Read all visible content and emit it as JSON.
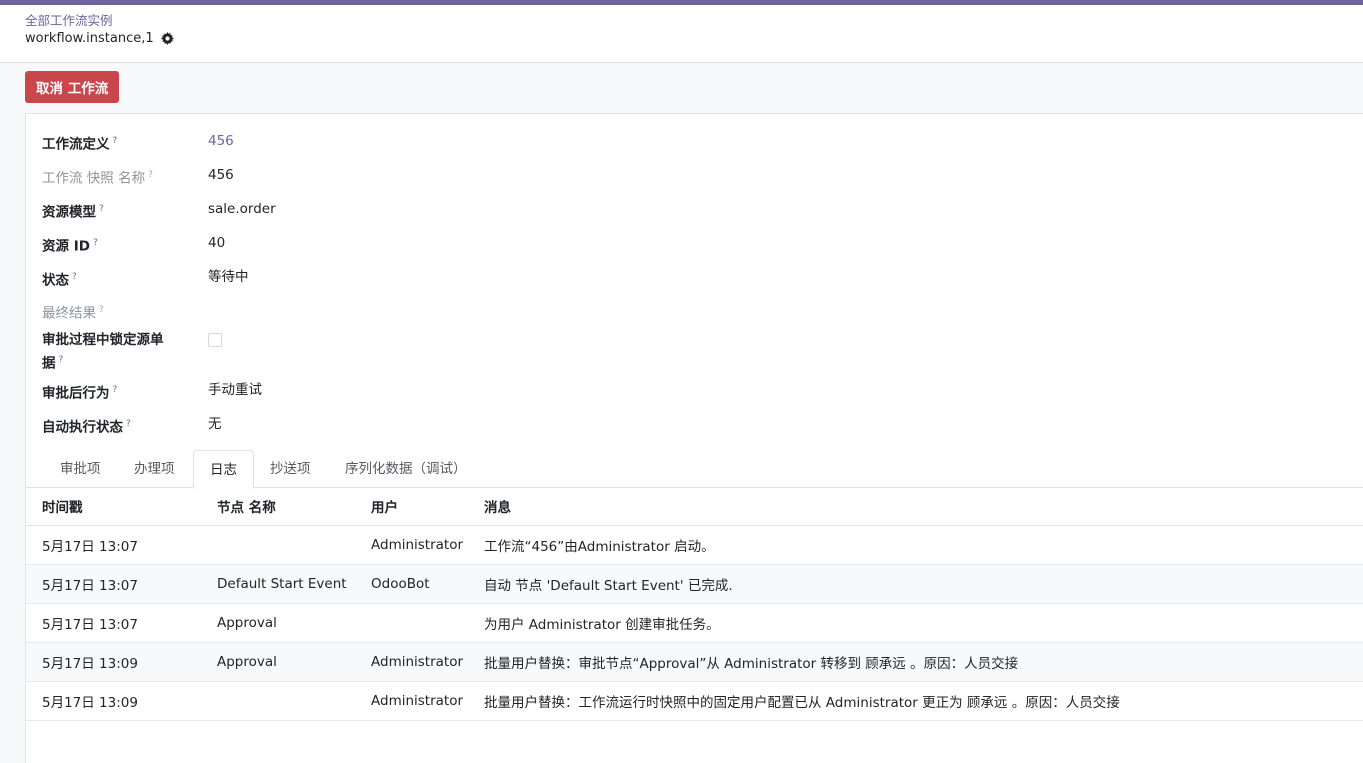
{
  "breadcrumb": {
    "parent": "全部工作流实例",
    "record": "workflow.instance,1"
  },
  "statusbar": {
    "cancel_label": "取消 工作流"
  },
  "fields": [
    {
      "label": "工作流定义",
      "help": "?",
      "value": "456"
    },
    {
      "label": "工作流 快照 名称",
      "help": "?",
      "value": "456"
    },
    {
      "label": "资源模型",
      "help": "?",
      "value": "sale.order"
    },
    {
      "label": "资源 ID",
      "help": "?",
      "value": "40"
    },
    {
      "label": "状态",
      "help": "?",
      "value": "等待中"
    },
    {
      "label": "最终结果",
      "help": "?",
      "value": ""
    },
    {
      "label_line1": "审批过程中锁定源单",
      "label_line2": "据",
      "help": "?"
    },
    {
      "label": "审批后行为",
      "help": "?",
      "value": "手动重试"
    },
    {
      "label": "自动执行状态",
      "help": "?",
      "value": "无"
    }
  ],
  "tabs": [
    {
      "label": "审批项"
    },
    {
      "label": "办理项"
    },
    {
      "label": "日志",
      "active": true
    },
    {
      "label": "抄送项"
    },
    {
      "label": "序列化数据（调试）"
    }
  ],
  "log_table": {
    "headers": [
      "时间戳",
      "节点 名称",
      "用户",
      "消息"
    ],
    "rows": [
      [
        "5月17日 13:07",
        "",
        "Administrator",
        "工作流“456”由Administrator 启动。"
      ],
      [
        "5月17日 13:07",
        "Default Start Event",
        "OdooBot",
        "自动 节点 'Default Start Event' 已完成."
      ],
      [
        "5月17日 13:07",
        "Approval",
        "",
        "为用户 Administrator 创建审批任务。"
      ],
      [
        "5月17日 13:09",
        "Approval",
        "Administrator",
        "批量用户替换：审批节点“Approval”从 Administrator 转移到 顾承远 。原因：人员交接"
      ],
      [
        "5月17日 13:09",
        "",
        "Administrator",
        "批量用户替换：工作流运行时快照中的固定用户配置已从 Administrator 更正为 顾承远 。原因：人员交接"
      ]
    ]
  },
  "colors": {
    "brand": "#71639e",
    "danger": "#c9464c"
  }
}
